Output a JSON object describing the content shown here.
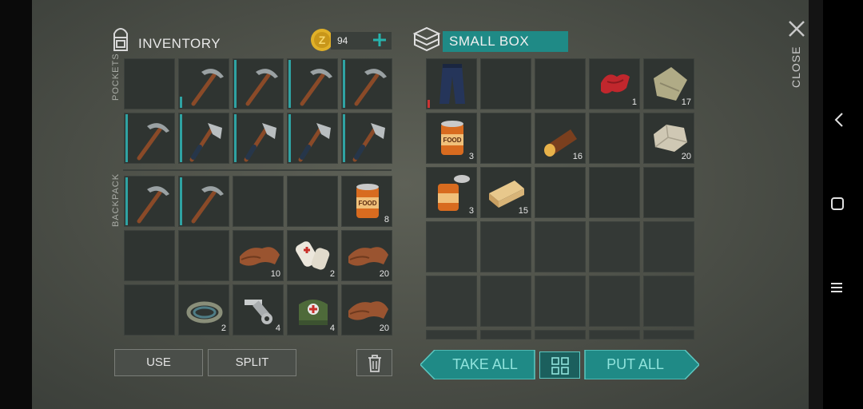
{
  "inventory": {
    "title": "INVENTORY",
    "coins": "94",
    "pockets_label": "POCKETS",
    "backpack_label": "BACKPACK",
    "pockets": [
      {
        "item": "",
        "count": ""
      },
      {
        "item": "pickaxe",
        "count": ""
      },
      {
        "item": "pickaxe",
        "count": ""
      },
      {
        "item": "pickaxe",
        "count": ""
      },
      {
        "item": "pickaxe",
        "count": ""
      },
      {
        "item": "pickaxe",
        "count": ""
      },
      {
        "item": "hatchet",
        "count": ""
      },
      {
        "item": "hatchet",
        "count": ""
      },
      {
        "item": "hatchet",
        "count": ""
      },
      {
        "item": "hatchet",
        "count": ""
      }
    ],
    "backpack": [
      {
        "item": "pickaxe",
        "count": ""
      },
      {
        "item": "pickaxe",
        "count": ""
      },
      {
        "item": "",
        "count": ""
      },
      {
        "item": "",
        "count": ""
      },
      {
        "item": "canned-food",
        "count": "8"
      },
      {
        "item": "",
        "count": ""
      },
      {
        "item": "",
        "count": ""
      },
      {
        "item": "leather",
        "count": "10"
      },
      {
        "item": "bandage",
        "count": "2"
      },
      {
        "item": "leather",
        "count": "20"
      },
      {
        "item": "",
        "count": ""
      },
      {
        "item": "rope",
        "count": "2"
      },
      {
        "item": "nuts-bolts",
        "count": "4"
      },
      {
        "item": "first-aid-kit",
        "count": "4"
      },
      {
        "item": "leather",
        "count": "20"
      }
    ],
    "use_label": "USE",
    "split_label": "SPLIT"
  },
  "box": {
    "title": "SMALL BOX",
    "slots": [
      {
        "item": "pants",
        "count": ""
      },
      {
        "item": "",
        "count": ""
      },
      {
        "item": "",
        "count": ""
      },
      {
        "item": "red-cloth",
        "count": "1"
      },
      {
        "item": "fabric",
        "count": "17"
      },
      {
        "item": "canned-food",
        "count": "3"
      },
      {
        "item": "",
        "count": ""
      },
      {
        "item": "log",
        "count": "16"
      },
      {
        "item": "",
        "count": ""
      },
      {
        "item": "stone",
        "count": "20"
      },
      {
        "item": "opened-can",
        "count": "3"
      },
      {
        "item": "plank",
        "count": "15"
      },
      {
        "item": "",
        "count": ""
      },
      {
        "item": "",
        "count": ""
      },
      {
        "item": "",
        "count": ""
      }
    ],
    "take_all_label": "TAKE ALL",
    "put_all_label": "PUT ALL"
  },
  "close_label": "CLOSE",
  "colors": {
    "accent": "#1f8a86",
    "durability": "#2fa3a3",
    "coin": "#e0b028"
  }
}
